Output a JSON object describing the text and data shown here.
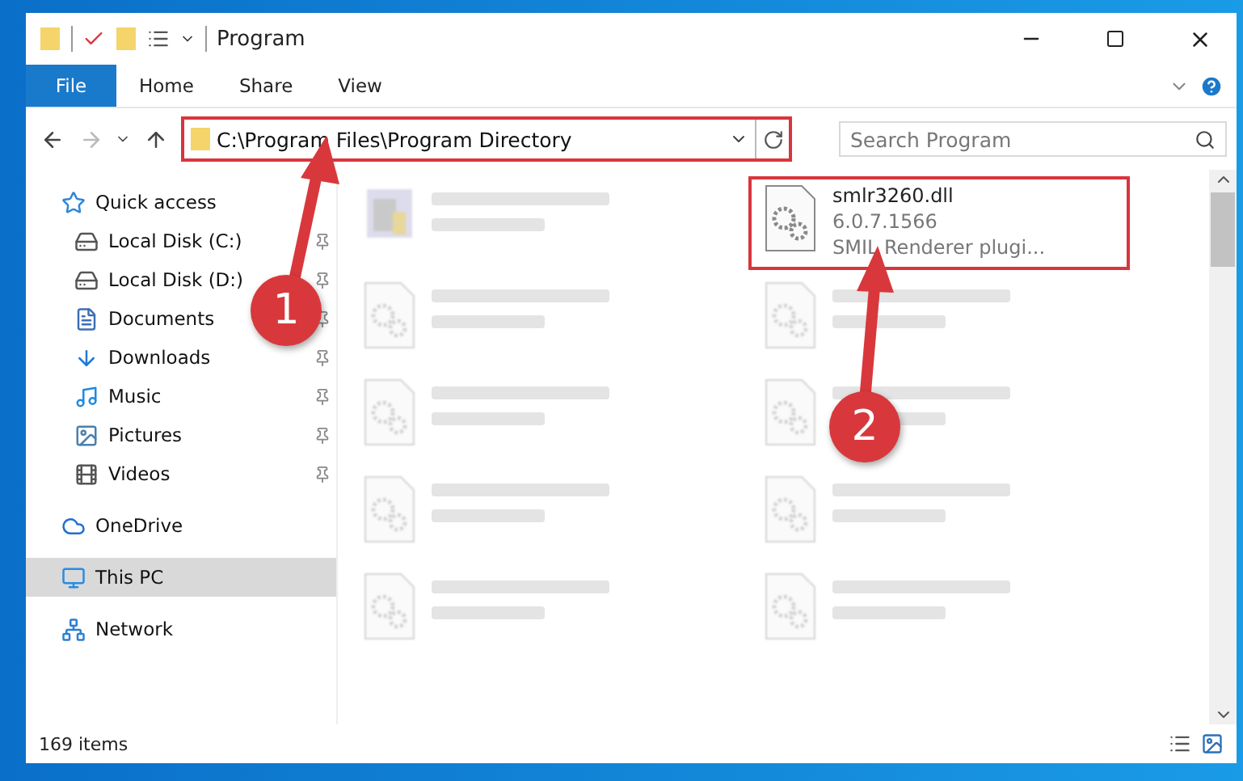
{
  "window": {
    "title": "Program"
  },
  "ribbon_tabs": [
    {
      "label": "File",
      "kind": "file"
    },
    {
      "label": "Home",
      "kind": "tab"
    },
    {
      "label": "Share",
      "kind": "tab"
    },
    {
      "label": "View",
      "kind": "tab"
    }
  ],
  "address": {
    "path": "C:\\Program Files\\Program Directory",
    "highlighted": true
  },
  "search": {
    "placeholder": "Search Program"
  },
  "sidebar": {
    "items": [
      {
        "label": "Quick access",
        "selected": false,
        "children": [
          {
            "label": "Local Disk (C:)",
            "pinned": true,
            "selected": false
          },
          {
            "label": "Local Disk (D:)",
            "pinned": true,
            "selected": false
          },
          {
            "label": "Documents",
            "pinned": true,
            "selected": false
          },
          {
            "label": "Downloads",
            "pinned": true,
            "selected": false
          },
          {
            "label": "Music",
            "pinned": true,
            "selected": false
          },
          {
            "label": "Pictures",
            "pinned": true,
            "selected": false
          },
          {
            "label": "Videos",
            "pinned": true,
            "selected": false
          }
        ]
      },
      {
        "label": "OneDrive",
        "selected": false
      },
      {
        "label": "This PC",
        "selected": true
      },
      {
        "label": "Network",
        "selected": false
      }
    ]
  },
  "files": [
    {
      "kind": "exe",
      "blurred": true,
      "highlighted": false
    },
    {
      "name": "smlr3260.dll",
      "details": [
        "6.0.7.1566",
        "SMIL Renderer plugi..."
      ],
      "kind": "dll",
      "blurred": false,
      "highlighted": true
    },
    {
      "kind": "dll",
      "blurred": true,
      "highlighted": false
    },
    {
      "kind": "dll",
      "blurred": true,
      "highlighted": false
    },
    {
      "kind": "dll",
      "blurred": true,
      "highlighted": false
    },
    {
      "kind": "dll",
      "blurred": true,
      "highlighted": false
    },
    {
      "kind": "dll",
      "blurred": true,
      "highlighted": false
    },
    {
      "kind": "dll",
      "blurred": true,
      "highlighted": false
    },
    {
      "kind": "dll",
      "blurred": true,
      "highlighted": false
    },
    {
      "kind": "dll",
      "blurred": true,
      "highlighted": false
    }
  ],
  "annotations": [
    {
      "label": "1"
    },
    {
      "label": "2"
    }
  ],
  "status_bar": {
    "count": "169 items"
  }
}
